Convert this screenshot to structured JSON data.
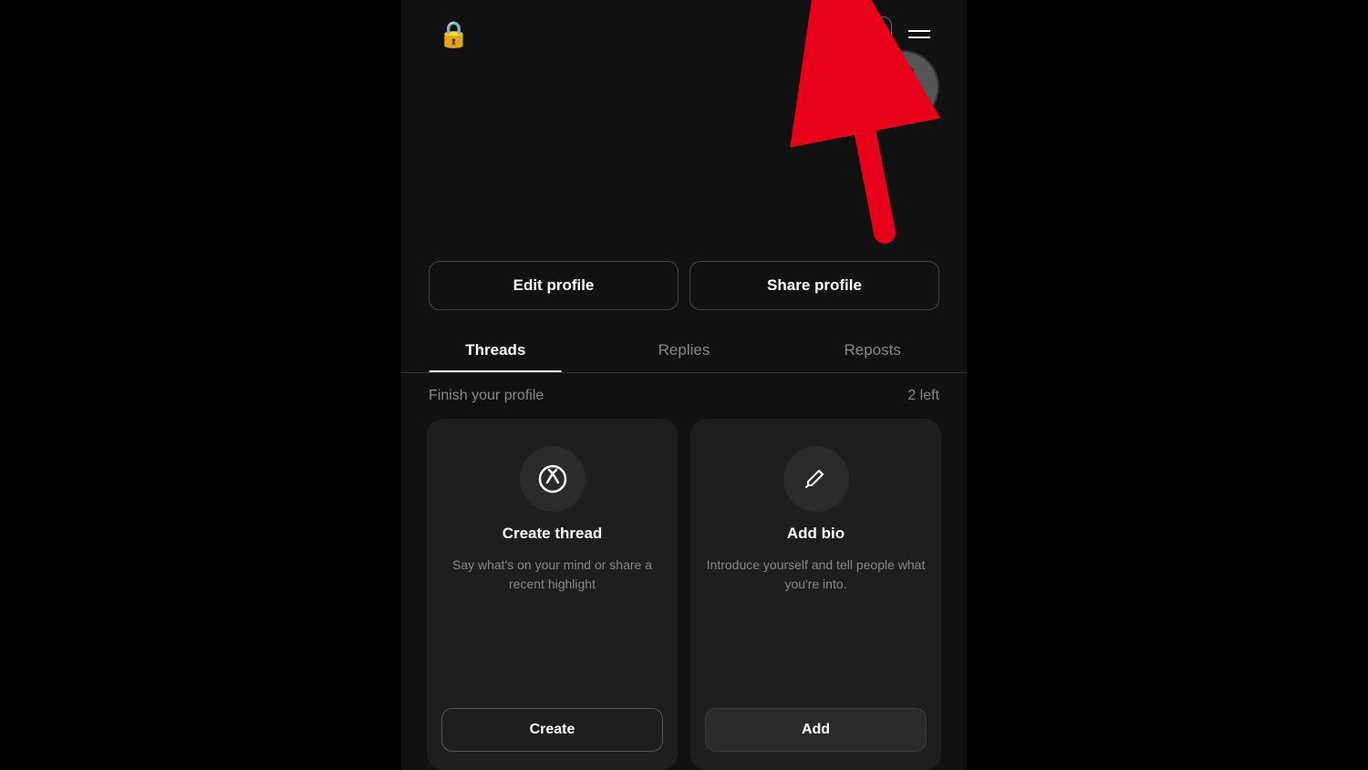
{
  "header": {
    "lock_icon": "🔒",
    "stats_icon": "📊",
    "menu_label": "menu"
  },
  "profile": {
    "edit_button": "Edit profile",
    "share_button": "Share profile"
  },
  "tabs": [
    {
      "label": "Threads",
      "active": true
    },
    {
      "label": "Replies",
      "active": false
    },
    {
      "label": "Reposts",
      "active": false
    }
  ],
  "finish_profile": {
    "label": "Finish your profile",
    "count": "2 left"
  },
  "cards": [
    {
      "title": "Create thread",
      "description": "Say what's on your mind or share a recent highlight",
      "button_label": "Create",
      "icon": "thread"
    },
    {
      "title": "Add bio",
      "description": "Introduce yourself and tell people what you're into.",
      "button_label": "Add",
      "icon": "pencil"
    }
  ]
}
